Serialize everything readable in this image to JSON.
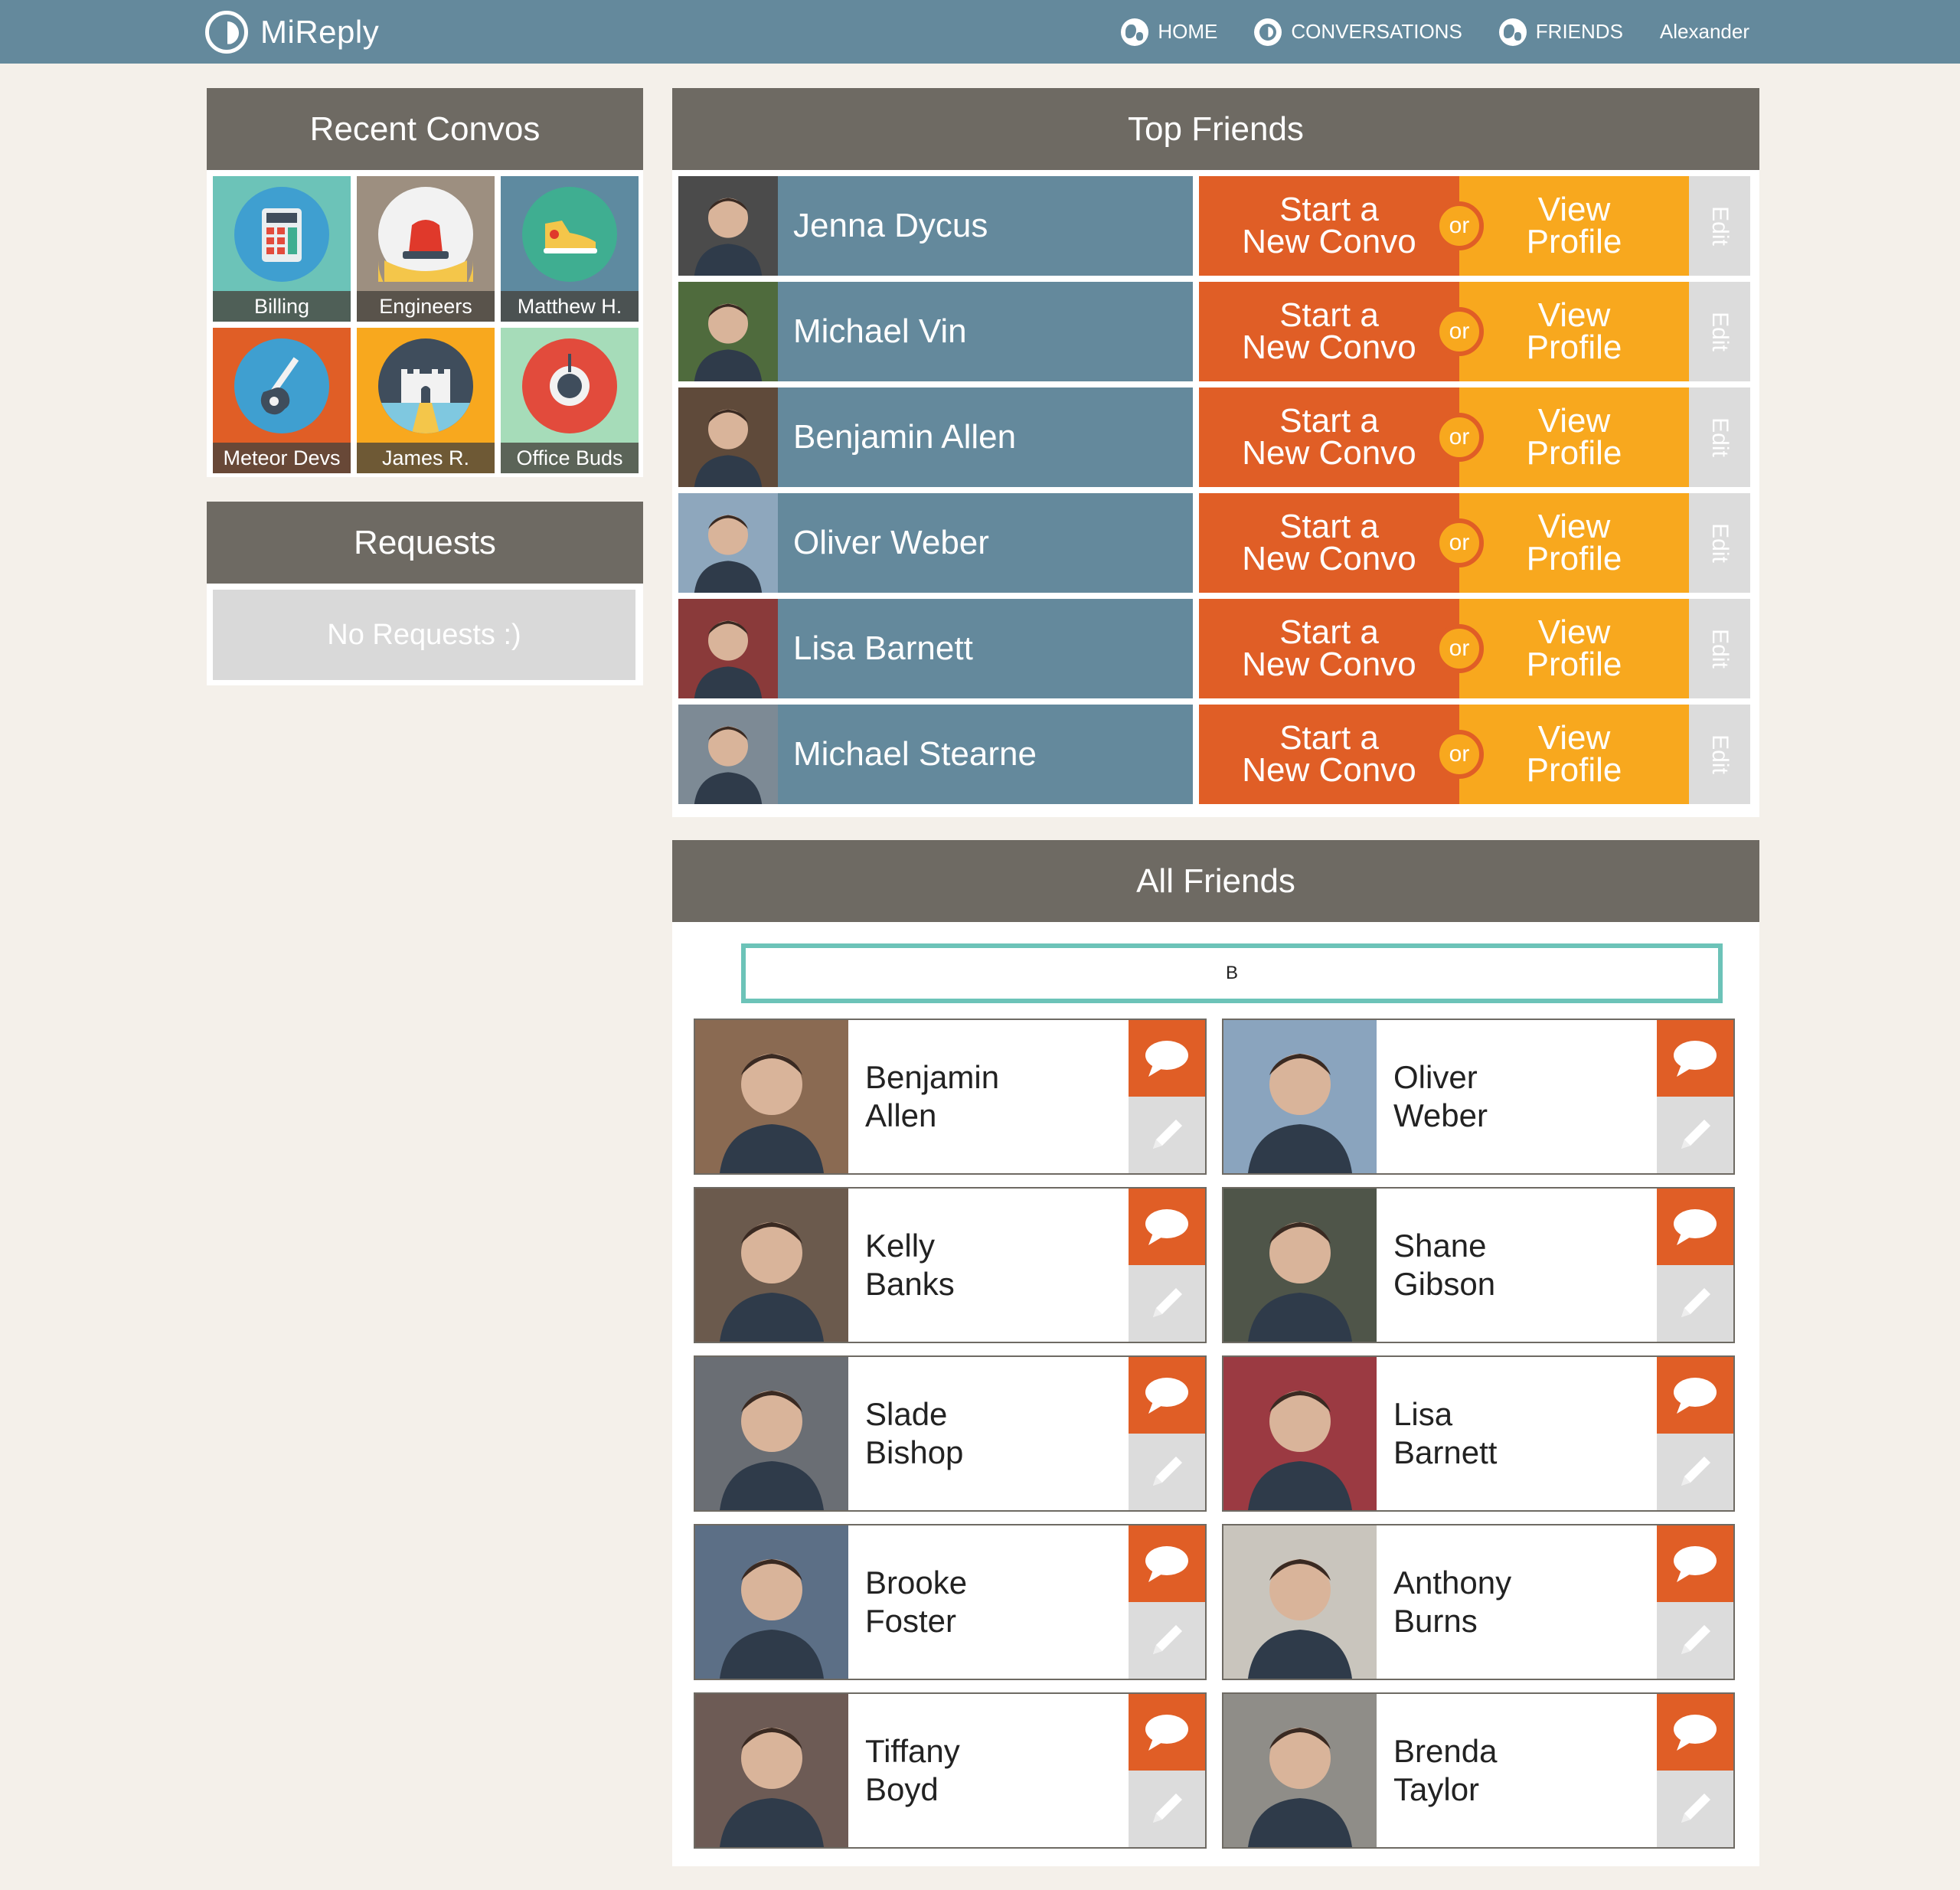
{
  "app": {
    "name": "MiReply"
  },
  "nav": {
    "home": "HOME",
    "conversations": "CONVERSATIONS",
    "friends": "FRIENDS",
    "user": "Alexander"
  },
  "recent_convos": {
    "title": "Recent Convos",
    "items": [
      {
        "label": "Billing",
        "icon": "calculator-icon",
        "bg": "#6cc3b8",
        "circle": "#3f9fd0"
      },
      {
        "label": "Engineers",
        "icon": "siren-icon",
        "bg": "#9d8f80",
        "circle": "#f2f2f2"
      },
      {
        "label": "Matthew H.",
        "icon": "sneaker-icon",
        "bg": "#5e8aa0",
        "circle": "#3fae91"
      },
      {
        "label": "Meteor Devs",
        "icon": "guitar-icon",
        "bg": "#e05e26",
        "circle": "#3f9fd0"
      },
      {
        "label": "James R.",
        "icon": "castle-icon",
        "bg": "#f8a81e",
        "circle": "#3f4d5c"
      },
      {
        "label": "Office Buds",
        "icon": "target-icon",
        "bg": "#a6dcb9",
        "circle": "#e24b3c"
      }
    ]
  },
  "requests": {
    "title": "Requests",
    "empty_text": "No Requests :)"
  },
  "top_friends": {
    "title": "Top Friends",
    "start_line1": "Start a",
    "start_line2": "New Convo",
    "or": "or",
    "view_line1": "View",
    "view_line2": "Profile",
    "edit": "Edit",
    "items": [
      {
        "name": "Jenna Dycus",
        "photo": "#4b4b4b"
      },
      {
        "name": "Michael Vin",
        "photo": "#4f6b3d"
      },
      {
        "name": "Benjamin Allen",
        "photo": "#5f4a3a"
      },
      {
        "name": "Oliver Weber",
        "photo": "#8ea7bd"
      },
      {
        "name": "Lisa Barnett",
        "photo": "#8a3a3a"
      },
      {
        "name": "Michael Stearne",
        "photo": "#7d8a95"
      }
    ]
  },
  "all_friends": {
    "title": "All Friends",
    "search_value": "B",
    "items": [
      {
        "first": "Benjamin",
        "last": "Allen",
        "photo": "#8a6a52"
      },
      {
        "first": "Oliver",
        "last": "Weber",
        "photo": "#8aa4be"
      },
      {
        "first": "Kelly",
        "last": "Banks",
        "photo": "#6b5a4d"
      },
      {
        "first": "Shane",
        "last": "Gibson",
        "photo": "#4f5549"
      },
      {
        "first": "Slade",
        "last": "Bishop",
        "photo": "#6a6e74"
      },
      {
        "first": "Lisa",
        "last": "Barnett",
        "photo": "#9b3a42"
      },
      {
        "first": "Brooke",
        "last": "Foster",
        "photo": "#5c6f86"
      },
      {
        "first": "Anthony",
        "last": "Burns",
        "photo": "#c9c5bd"
      },
      {
        "first": "Tiffany",
        "last": "Boyd",
        "photo": "#6d5b55"
      },
      {
        "first": "Brenda",
        "last": "Taylor",
        "photo": "#8f8d88"
      }
    ]
  },
  "colors": {
    "topbar": "#64899c",
    "panel_header": "#6e6a63",
    "start_convo": "#e05e26",
    "view_profile": "#f8a81e",
    "search_border": "#6cc3b8"
  }
}
